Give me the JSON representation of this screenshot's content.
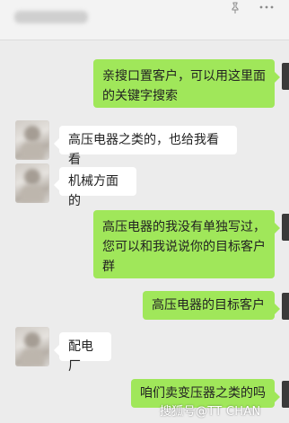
{
  "header": {
    "pin_icon": "pin-icon",
    "more_icon": "more-icon"
  },
  "messages": [
    {
      "side": "out",
      "text": "亲搜口置客户，可以用这里面\n的关键字搜索"
    },
    {
      "side": "in",
      "text": "高压电器之类的，也给我看看"
    },
    {
      "side": "in",
      "text": "机械方面的"
    },
    {
      "side": "out",
      "text": "高压电器的我没有单独写过，\n您可以和我说说你的目标客户\n群"
    },
    {
      "side": "out",
      "text": "高压电器的目标客户"
    },
    {
      "side": "in",
      "text": "配电厂"
    },
    {
      "side": "out",
      "text": "咱们卖变压器之类的吗"
    }
  ],
  "watermark": "搜狐号@TT CHAN",
  "colors": {
    "out_bubble": "#a0e75a",
    "in_bubble": "#ffffff",
    "background": "#ececec"
  }
}
